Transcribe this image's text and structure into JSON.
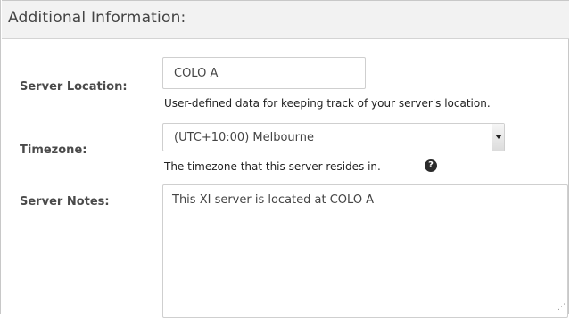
{
  "section": {
    "title": "Additional Information:"
  },
  "server_location": {
    "label": "Server Location:",
    "value": "COLO A",
    "help": "User-defined data for keeping track of your server's location."
  },
  "timezone": {
    "label": "Timezone:",
    "selected": "(UTC+10:00) Melbourne",
    "help": "The timezone that this server resides in.",
    "help_icon": "question-circle-icon"
  },
  "server_notes": {
    "label": "Server Notes:",
    "value": "This XI server is located at COLO A"
  }
}
